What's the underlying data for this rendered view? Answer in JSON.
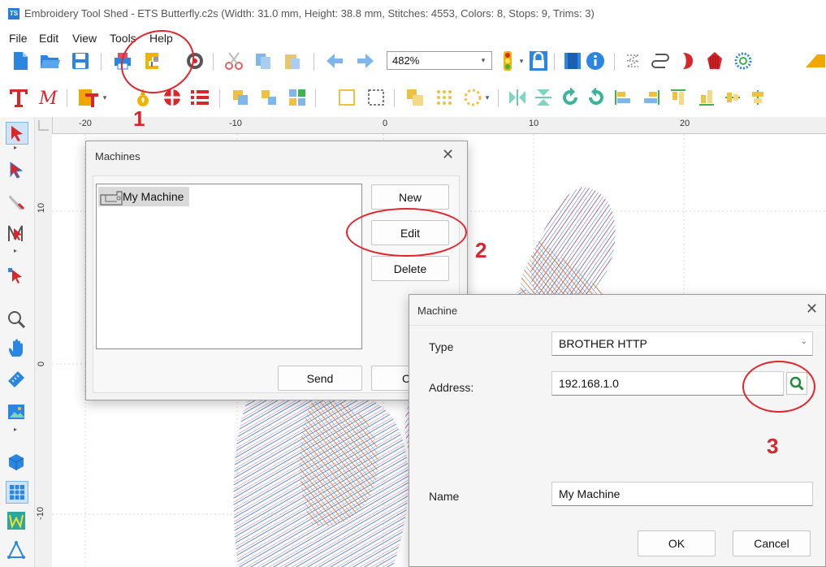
{
  "window": {
    "title": "Embroidery Tool Shed - ETS Butterfly.c2s (Width: 31.0 mm, Height: 38.8 mm, Stitches: 4553, Colors: 8, Stops: 9, Trims: 3)",
    "app_icon_text": "TS"
  },
  "menu": [
    "File",
    "Edit",
    "View",
    "Tools",
    "Help"
  ],
  "toolbar": {
    "zoom_value": "482%"
  },
  "ruler": {
    "h_ticks": [
      "-20",
      "-10",
      "0",
      "10",
      "20"
    ],
    "v_ticks": [
      "10",
      "0",
      "-10"
    ]
  },
  "machines_dialog": {
    "title": "Machines",
    "list_items": [
      "My Machine"
    ],
    "new_label": "New",
    "edit_label": "Edit",
    "delete_label": "Delete",
    "send_label": "Send",
    "close_label": "Clos"
  },
  "machine_dialog": {
    "title": "Machine",
    "type_label": "Type",
    "type_value": "BROTHER HTTP",
    "address_label": "Address:",
    "address_value": "192.168.1.0",
    "name_label": "Name",
    "name_value": "My Machine",
    "ok_label": "OK",
    "cancel_label": "Cancel"
  },
  "annotations": {
    "step1": "1",
    "step2": "2",
    "step3": "3"
  },
  "colors": {
    "accent_red": "#e0262a",
    "toolbar_blue": "#2a86e0",
    "selection_gray": "#d9d9d9"
  }
}
